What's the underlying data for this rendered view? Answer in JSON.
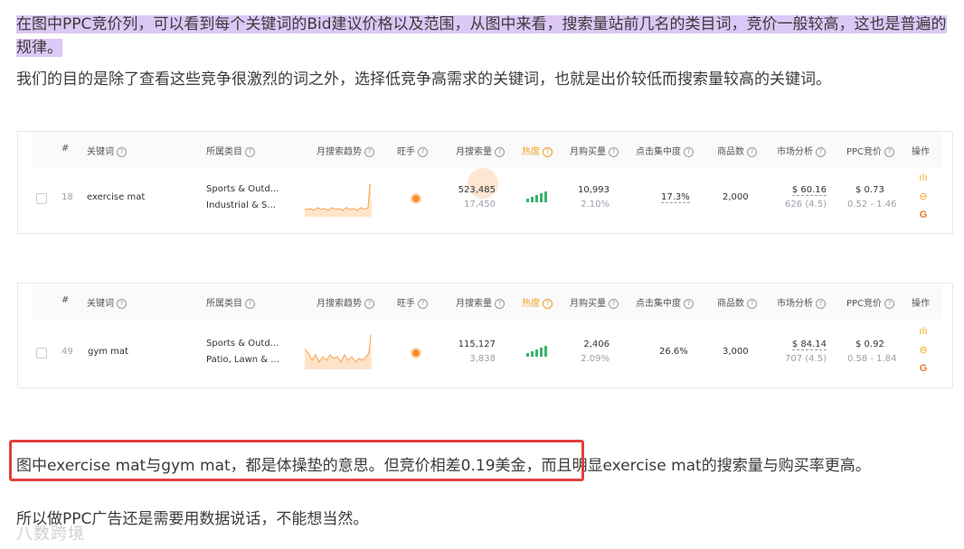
{
  "paragraphs": {
    "p1": "在图中PPC竞价列，可以看到每个关键词的Bid建议价格以及范围，从图中来看，搜索量站前几名的类目词，竞价一般较高，这也是普遍的规律。",
    "p2": "我们的目的是除了查看这些竞争很激烈的词之外，选择低竞争高需求的关键词，也就是出价较低而搜索量较高的关键词。",
    "p3_boxed": "图中exercise mat与gym mat，都是体操垫的意思。但竞价相差0.19美金，",
    "p3_rest": "而且明显exercise mat的搜索量与购买率更高。",
    "p4": "所以做PPC广告还是需要用数据说话，不能想当然。"
  },
  "watermark": "八数跨境",
  "table_headers": {
    "index": "#",
    "keyword": "关键词",
    "category": "所属类目",
    "trend": "月搜索趋势",
    "wangshou": "旺手",
    "search_volume": "月搜索量",
    "heat": "热度",
    "purchase": "月购买量",
    "click_concentration": "点击集中度",
    "product_count": "商品数",
    "market": "市场分析",
    "ppc": "PPC竞价",
    "ops": "操作"
  },
  "icons": {
    "help": "question-circle-icon",
    "trend_chart": "bar-chart-icon",
    "more": "more-circle-icon",
    "google": "google-icon"
  },
  "colors": {
    "highlight": "#dcc7f5",
    "red_box": "#e04040",
    "heat_bars": "#3bb36e",
    "orange_dot": "#ff8c2a",
    "hot_header": "#f0a020"
  },
  "rows": [
    {
      "index": "18",
      "keyword": "exercise mat",
      "category1": "Sports & Outd...",
      "category2": "Industrial & S...",
      "search_volume": "523,485",
      "search_volume_sub": "17,450",
      "purchase": "10,993",
      "purchase_rate": "2.10%",
      "click_concentration": "17.3%",
      "product_count": "2,000",
      "price": "$ 60.16",
      "rating": "626 (4.5)",
      "ppc": "$ 0.73",
      "ppc_range": "0.52 - 1.46"
    },
    {
      "index": "49",
      "keyword": "gym mat",
      "category1": "Sports & Outd...",
      "category2": "Patio, Lawn & ...",
      "search_volume": "115,127",
      "search_volume_sub": "3,838",
      "purchase": "2,406",
      "purchase_rate": "2.09%",
      "click_concentration": "26.6%",
      "product_count": "3,000",
      "price": "$ 84.14",
      "rating": "707 (4.5)",
      "ppc": "$ 0.92",
      "ppc_range": "0.58 - 1.84"
    }
  ]
}
